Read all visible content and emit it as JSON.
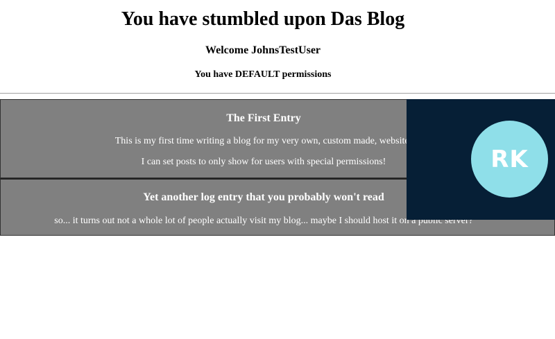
{
  "header": {
    "title": "You have stumbled upon Das Blog",
    "welcome": "Welcome JohnsTestUser",
    "permissions": "You have DEFAULT permissions"
  },
  "entries": [
    {
      "title": "The First Entry",
      "lines": [
        "This is my first time writing a blog for my very own, custom made, website!",
        "I can set posts to only show for users with special permissions!"
      ]
    },
    {
      "title": "Yet another log entry that you probably won't read",
      "lines": [
        "so... it turns out not a whole lot of people actually visit my blog... maybe I should host it on a public server?"
      ]
    }
  ],
  "avatar": {
    "initials": "RK"
  },
  "colors": {
    "entry_background": "#808080",
    "avatar_panel": "#061f36",
    "avatar_circle": "#8fdfe9"
  }
}
